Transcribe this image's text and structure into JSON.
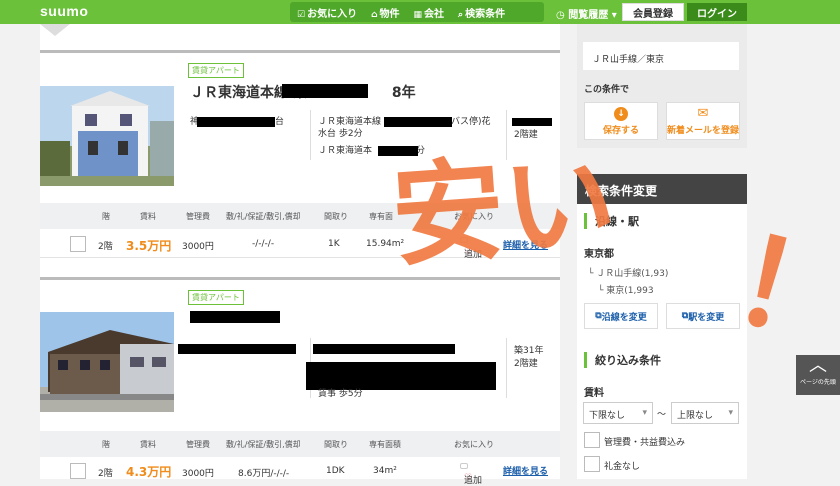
{
  "header": {
    "logo": "suumo",
    "nav": [
      {
        "icon": "☑",
        "label": "お気に入り"
      },
      {
        "icon": "⌂",
        "label": "物件"
      },
      {
        "icon": "▦",
        "label": "会社"
      },
      {
        "icon": "⌕",
        "label": "検索条件"
      }
    ],
    "history": "閲覧履歴 ▾",
    "register": "会員登録",
    "login": "ログイン"
  },
  "listings": [
    {
      "tag": "賃貸アパート",
      "title": "ＪＲ東海道本線 東",
      "title_suffix": "8年",
      "address": "神",
      "address_suffix": "台",
      "access1": "ＪＲ東海道本線",
      "access1_suffix": "バス停)花",
      "access1_line2": "水台 歩2分",
      "access2": "ＪＲ東海道本",
      "access2_suffix": "分",
      "age": "",
      "floors": "2階建",
      "headers": [
        "階",
        "賃料",
        "管理費",
        "敷/礼/保証/敷引,償却",
        "間取り",
        "専有面",
        "お気に入り"
      ],
      "row": {
        "floor": "2階",
        "rent": "3.5万円",
        "fee": "3000円",
        "deposit": "-/-/-/-",
        "layout": "1K",
        "area": "15.94m²",
        "fav": "追加",
        "detail": "詳細を見る"
      }
    },
    {
      "tag": "賃貸アパート",
      "title": "",
      "address": "",
      "access_partial": "賃事 歩5分",
      "age": "築31年",
      "floors": "2階建",
      "headers": [
        "階",
        "賃料",
        "管理費",
        "敷/礼/保証/敷引,償却",
        "間取り",
        "専有面積",
        "お気に入り"
      ],
      "row": {
        "floor": "2階",
        "rent": "4.3万円",
        "fee": "3000円",
        "deposit": "8.6万円/-/-/-",
        "layout": "1DK",
        "area": "34m²",
        "fav": "追加",
        "detail": "詳細を見る"
      }
    }
  ],
  "sidebar": {
    "current_condition": "ＪＲ山手線／東京",
    "with_condition": "この条件で",
    "save_btn": "保存する",
    "mail_btn": "新着メールを登録",
    "change_title": "検索条件変更",
    "route_section": "沿線・駅",
    "pref": "東京都",
    "line": "ＪＲ山手線(1,9",
    "line_suffix": "3)",
    "station": "東京(1,993",
    "change_line": "沿線を変更",
    "change_station": "駅を変更",
    "filter_section": "絞り込み条件",
    "rent_label": "賃料",
    "lower": "下限なし",
    "tilde": "〜",
    "upper": "上限なし",
    "opt1": "管理費・共益費込み",
    "opt2": "礼金なし",
    "page_top": "ページの先頭"
  },
  "overlay": {
    "line1": "安い",
    "line2": "！"
  },
  "colors": {
    "brand": "#6bc13a",
    "price": "#f08c1b",
    "link": "#1b5eaa",
    "overlay": "#f07a42"
  }
}
